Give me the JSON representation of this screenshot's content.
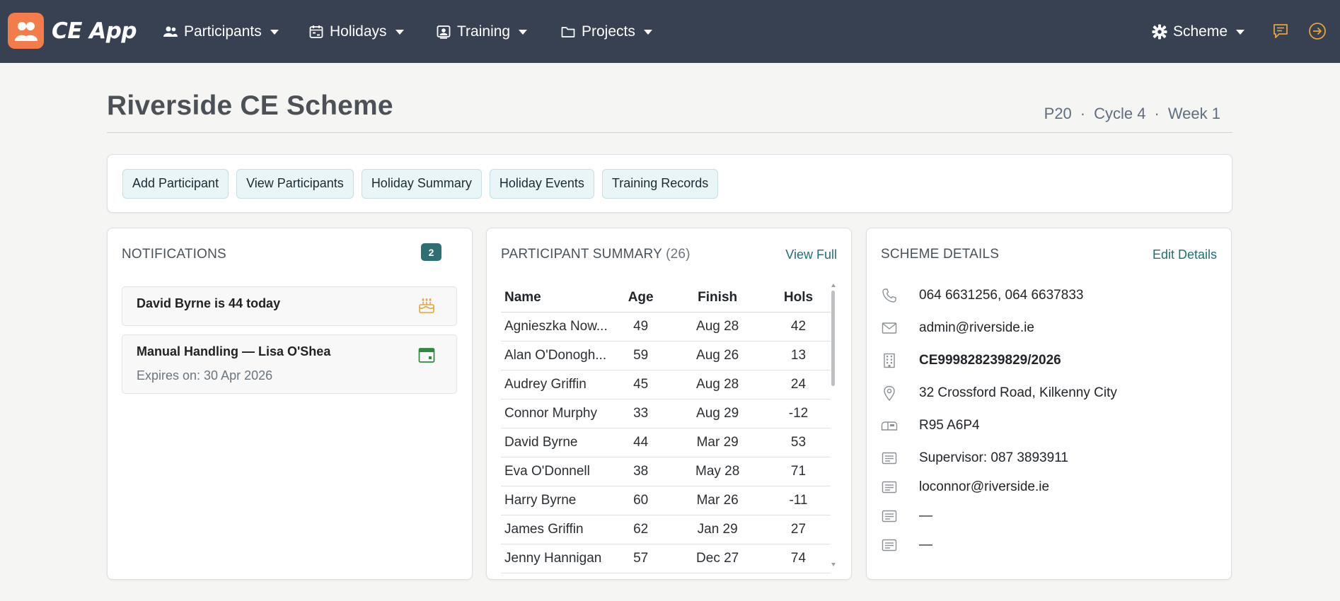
{
  "nav": {
    "brand": "CE App",
    "menu": [
      {
        "label": "Participants"
      },
      {
        "label": "Holidays"
      },
      {
        "label": "Training"
      },
      {
        "label": "Projects"
      }
    ],
    "scheme_label": "Scheme"
  },
  "header": {
    "title": "Riverside CE Scheme",
    "period": "P20",
    "cycle": "Cycle 4",
    "week": "Week 1",
    "separator": "·"
  },
  "actions": [
    {
      "label": "Add Participant"
    },
    {
      "label": "View Participants"
    },
    {
      "label": "Holiday Summary"
    },
    {
      "label": "Holiday Events"
    },
    {
      "label": "Training Records"
    }
  ],
  "notifications": {
    "title": "NOTIFICATIONS",
    "count": "2",
    "items": [
      {
        "title": "David Byrne is 44 today",
        "subtitle": "",
        "icon": "birthday-cake-icon"
      },
      {
        "title": "Manual Handling — Lisa O'Shea",
        "subtitle": "Expires on: 30 Apr 2026",
        "icon": "calendar-icon"
      }
    ]
  },
  "summary": {
    "title": "PARTICIPANT SUMMARY",
    "count": "(26)",
    "link": "View Full",
    "columns": [
      "Name",
      "Age",
      "Finish",
      "Hols"
    ],
    "rows": [
      [
        "Agnieszka Now...",
        "49",
        "Aug 28",
        "42"
      ],
      [
        "Alan O'Donogh...",
        "59",
        "Aug 26",
        "13"
      ],
      [
        "Audrey Griffin",
        "45",
        "Aug 28",
        "24"
      ],
      [
        "Connor Murphy",
        "33",
        "Aug 29",
        "-12"
      ],
      [
        "David Byrne",
        "44",
        "Mar 29",
        "53"
      ],
      [
        "Eva O'Donnell",
        "38",
        "May 28",
        "71"
      ],
      [
        "Harry Byrne",
        "60",
        "Mar 26",
        "-11"
      ],
      [
        "James Griffin",
        "62",
        "Jan 29",
        "27"
      ],
      [
        "Jenny Hannigan",
        "57",
        "Dec 27",
        "74"
      ]
    ]
  },
  "details": {
    "title": "SCHEME DETAILS",
    "link": "Edit Details",
    "rows": [
      {
        "icon": "phone-icon",
        "text": "064 6631256, 064 6637833"
      },
      {
        "icon": "envelope-icon",
        "text": "admin@riverside.ie"
      },
      {
        "icon": "building-icon",
        "text": "CE999828239829/2026"
      },
      {
        "icon": "location-pin-icon",
        "text": "32 Crossford Road, Kilkenny City"
      },
      {
        "icon": "mailbox-icon",
        "text": "R95 A6P4"
      },
      {
        "icon": "note-icon",
        "text": "Supervisor: 087 3893911"
      },
      {
        "icon": "note-icon",
        "text": "loconnor@riverside.ie"
      },
      {
        "icon": "note-icon",
        "text": "—"
      },
      {
        "icon": "note-icon",
        "text": "—"
      }
    ]
  },
  "colors": {
    "navbar": "#374151",
    "brand_logo": "#f47c4a",
    "accent_teal": "#2f6e72",
    "icon_orange": "#e8a33a"
  }
}
